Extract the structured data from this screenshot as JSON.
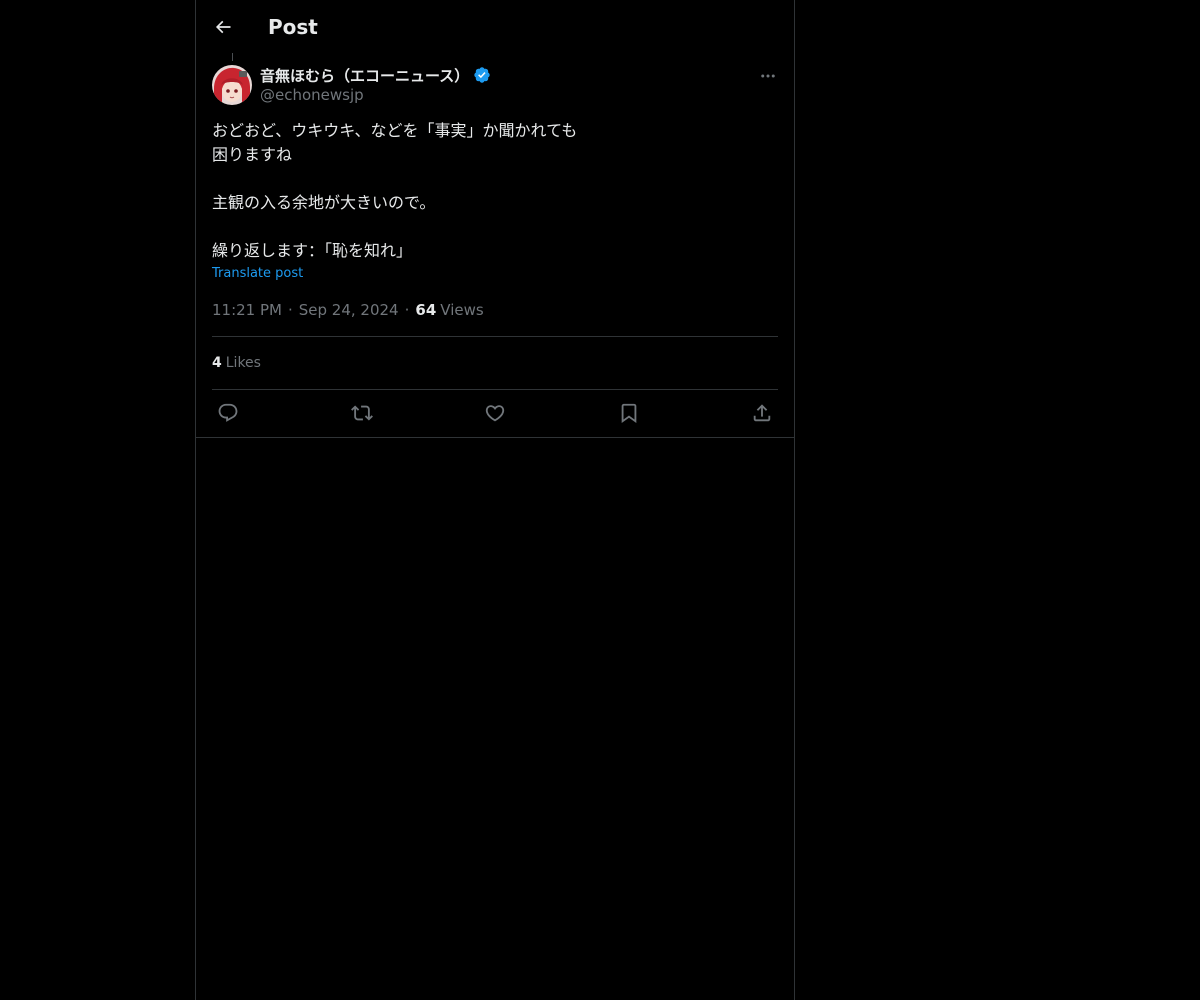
{
  "header": {
    "title": "Post",
    "back_icon": "arrow-left-icon"
  },
  "author": {
    "display_name": "音無ほむら（エコーニュース）",
    "handle": "@echonewsjp",
    "verified": true,
    "verified_color": "#1d9bf0",
    "avatar_icon": "avatar"
  },
  "post": {
    "lines": [
      "おどおど、ウキウキ、などを「事実」か聞かれても",
      "困りますね",
      "",
      "主観の入る余地が大きいので。",
      "",
      "繰り返します：「恥を知れ」"
    ],
    "translate_label": "Translate post",
    "time": "11:21 PM",
    "date": "Sep 24, 2024",
    "separator": "·",
    "views_count": "64",
    "views_label": "Views"
  },
  "engagement": {
    "likes_count": "4",
    "likes_label": "Likes"
  },
  "actions": [
    {
      "name": "reply-button",
      "icon": "reply-icon"
    },
    {
      "name": "repost-button",
      "icon": "repost-icon"
    },
    {
      "name": "like-button",
      "icon": "heart-icon"
    },
    {
      "name": "bookmark-button",
      "icon": "bookmark-icon"
    },
    {
      "name": "share-button",
      "icon": "share-icon"
    }
  ],
  "colors": {
    "background": "#000000",
    "text": "#e7e9ea",
    "secondary_text": "#71767b",
    "link": "#1d9bf0",
    "border": "#2f3336"
  }
}
